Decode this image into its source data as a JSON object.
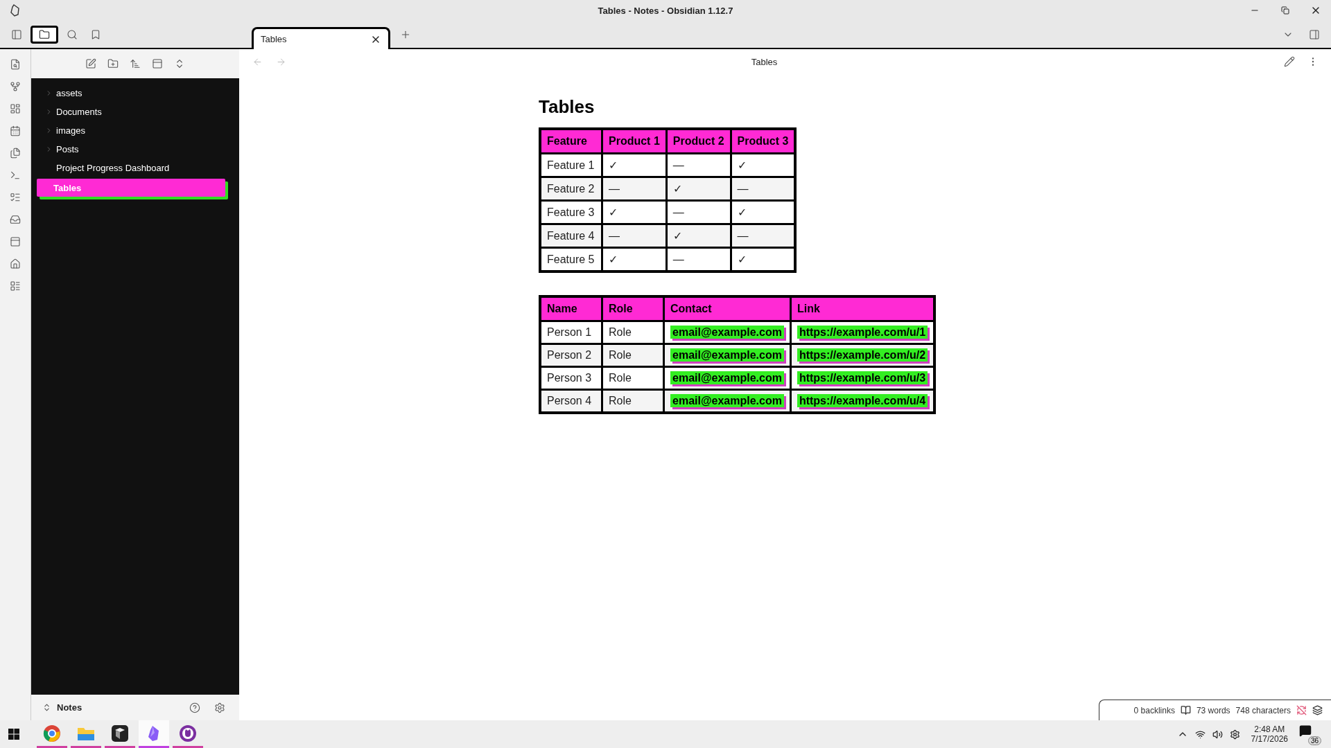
{
  "window": {
    "title": "Tables - Notes - Obsidian 1.12.7"
  },
  "tabs": [
    {
      "label": "Tables",
      "selected": true
    }
  ],
  "sidebar": {
    "items": [
      {
        "label": "assets",
        "kind": "folder",
        "expanded": false,
        "selected": false
      },
      {
        "label": "Documents",
        "kind": "folder",
        "expanded": false,
        "selected": false
      },
      {
        "label": "images",
        "kind": "folder",
        "expanded": false,
        "selected": false
      },
      {
        "label": "Posts",
        "kind": "folder",
        "expanded": false,
        "selected": false
      },
      {
        "label": "Project Progress Dashboard",
        "kind": "file",
        "selected": false
      },
      {
        "label": "Tables",
        "kind": "file",
        "selected": true
      }
    ],
    "vault": "Notes"
  },
  "note": {
    "header_title": "Tables",
    "heading": "Tables",
    "tables": [
      {
        "columns": [
          {
            "label": "Feature",
            "kind": "plain"
          },
          {
            "label": "Product 1",
            "kind": "plain"
          },
          {
            "label": "Product 2",
            "kind": "plain"
          },
          {
            "label": "Product 3",
            "kind": "plain"
          }
        ],
        "rows": [
          [
            "Feature 1",
            "✓",
            "—",
            "✓"
          ],
          [
            "Feature 2",
            "—",
            "✓",
            "—"
          ],
          [
            "Feature 3",
            "✓",
            "—",
            "✓"
          ],
          [
            "Feature 4",
            "—",
            "✓",
            "—"
          ],
          [
            "Feature 5",
            "✓",
            "—",
            "✓"
          ]
        ]
      },
      {
        "columns": [
          {
            "label": "Name",
            "kind": "plain"
          },
          {
            "label": "Role",
            "kind": "plain"
          },
          {
            "label": "Contact",
            "kind": "highlight"
          },
          {
            "label": "Link",
            "kind": "highlight"
          }
        ],
        "rows": [
          [
            "Person 1",
            "Role",
            "email@example.com",
            "https://example.com/u/1"
          ],
          [
            "Person 2",
            "Role",
            "email@example.com",
            "https://example.com/u/2"
          ],
          [
            "Person 3",
            "Role",
            "email@example.com",
            "https://example.com/u/3"
          ],
          [
            "Person 4",
            "Role",
            "email@example.com",
            "https://example.com/u/4"
          ]
        ]
      }
    ]
  },
  "status_bar": {
    "backlinks": "0 backlinks",
    "words": "73 words",
    "characters": "748 characters"
  },
  "taskbar": {
    "apps": [
      {
        "kind": "browser",
        "selected": false
      },
      {
        "kind": "files",
        "selected": false
      },
      {
        "kind": "cube",
        "selected": false
      },
      {
        "kind": "gem",
        "selected": true
      },
      {
        "kind": "cat",
        "selected": false
      }
    ],
    "time": "2:48 AM",
    "date": "7/17/2026",
    "notifications": "36"
  }
}
